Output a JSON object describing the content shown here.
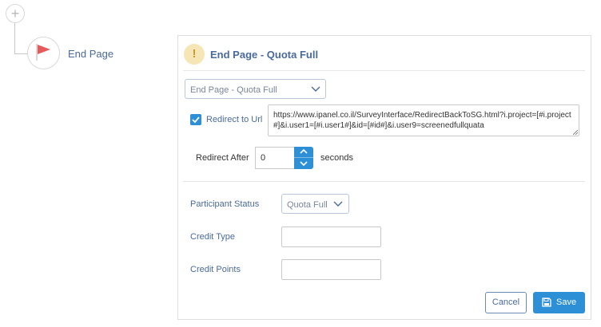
{
  "flow": {
    "add_node_glyph": "+",
    "end_node_label": "End Page"
  },
  "panel": {
    "warning_glyph": "!",
    "title": "End Page - Quota Full",
    "end_page_select": "End Page - Quota Full",
    "redirect": {
      "checked": true,
      "label": "Redirect to Url",
      "url": "https://www.ipanel.co.il/SurveyInterface/RedirectBackToSG.html?i.project=[#i.project#]&i.user1=[#i.user1#]&id=[#id#]&i.user9=screenedfullquata"
    },
    "redirect_after": {
      "label": "Redirect After",
      "value": "0",
      "unit": "seconds"
    },
    "participant_status": {
      "label": "Participant Status",
      "value": "Quota Full"
    },
    "credit_type": {
      "label": "Credit Type",
      "value": ""
    },
    "credit_points": {
      "label": "Credit Points",
      "value": ""
    },
    "buttons": {
      "cancel": "Cancel",
      "save": "Save"
    }
  },
  "colors": {
    "accent": "#2d8fd5",
    "label_blue": "#4a6a9c",
    "warning_bg": "#f7e6b5",
    "flag_red": "#e65a5a"
  },
  "icons": {
    "add_node": "plus-icon",
    "end_node": "flag-icon",
    "warning": "exclamation-icon",
    "dropdown": "chevron-down-icon",
    "check": "checkmark-icon",
    "spinner_up": "chevron-up-icon",
    "spinner_down": "chevron-down-icon",
    "save": "floppy-disk-icon"
  }
}
